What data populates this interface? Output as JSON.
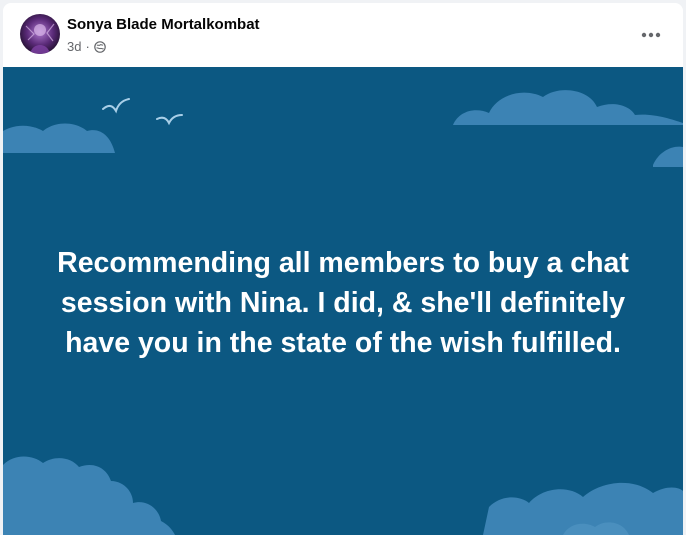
{
  "post": {
    "author": "Sonya Blade Mortalkombat",
    "time": "3d",
    "separator": "·",
    "audience_icon": "globe-icon",
    "more_icon": "more-options-icon",
    "text": "Recommending all members to buy a chat session with Nina. I did, & she'll definitely have you in the state of the wish fulfilled."
  },
  "colors": {
    "background_sky": "#0c5882",
    "clouds": "#3c83b4",
    "birds": "#a9cfe8",
    "text": "#ffffff"
  }
}
